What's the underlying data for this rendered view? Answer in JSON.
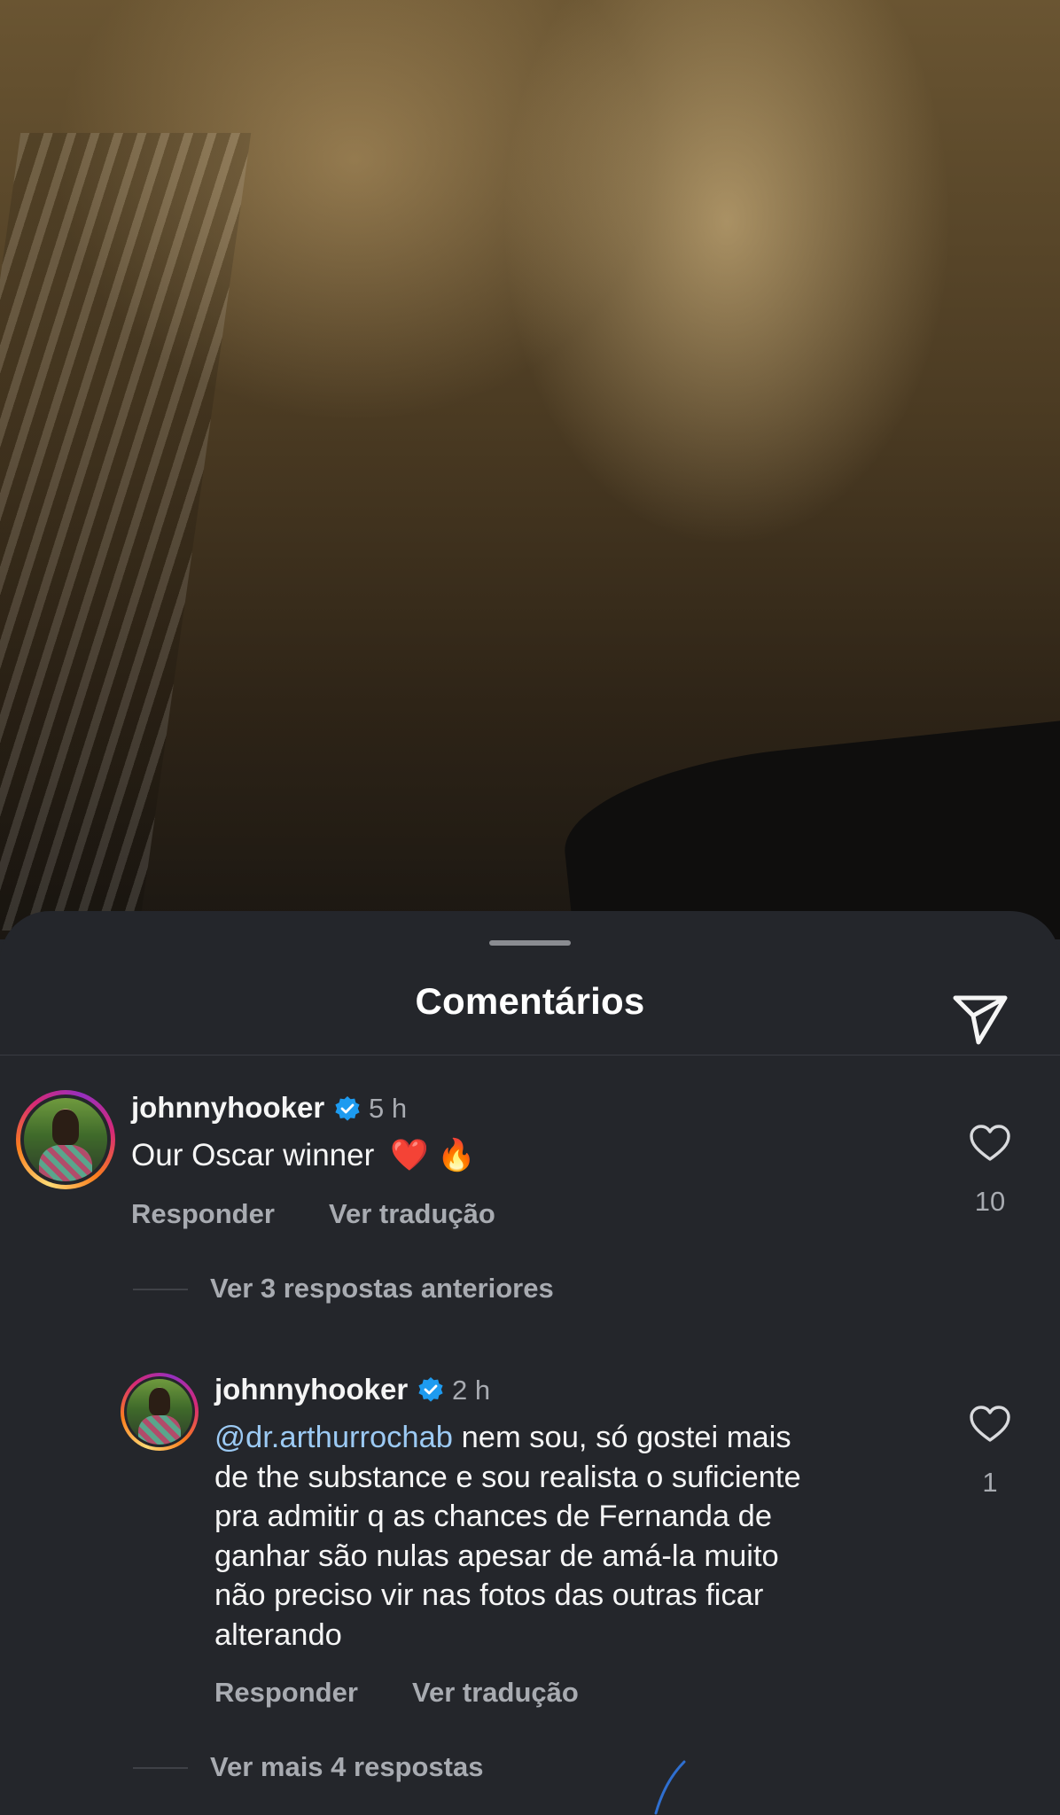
{
  "sheet": {
    "title": "Comentários"
  },
  "comments": [
    {
      "username": "johnnyhooker",
      "time": "5 h",
      "text": "Our Oscar winner",
      "emoji": "❤️ 🔥",
      "actions": {
        "reply": "Responder",
        "translate": "Ver tradução"
      },
      "likes": "10",
      "previous_replies_link": "Ver 3 respostas anteriores"
    }
  ],
  "replies": [
    {
      "username": "johnnyhooker",
      "time": "2 h",
      "mention": "@dr.arthurrochab",
      "lines": [
        " nem sou, só gostei mais",
        "de the substance e sou realista o suficiente",
        "pra admitir q as chances de Fernanda de",
        "ganhar são nulas apesar de amá-la muito",
        "não preciso vir nas fotos das outras ficar",
        "alterando"
      ],
      "actions": {
        "reply": "Responder",
        "translate": "Ver tradução"
      },
      "likes": "1",
      "more_replies_link": "Ver mais 4 respostas"
    }
  ],
  "colors": {
    "sheet_bg": "#24262b",
    "secondary_text": "#a8abb1",
    "mention": "#9ccaf4",
    "verified_badge": "#1d9bf0"
  },
  "icons": {
    "share": "paper-plane-icon",
    "like": "heart-outline-icon",
    "verified": "verified-badge-icon"
  }
}
